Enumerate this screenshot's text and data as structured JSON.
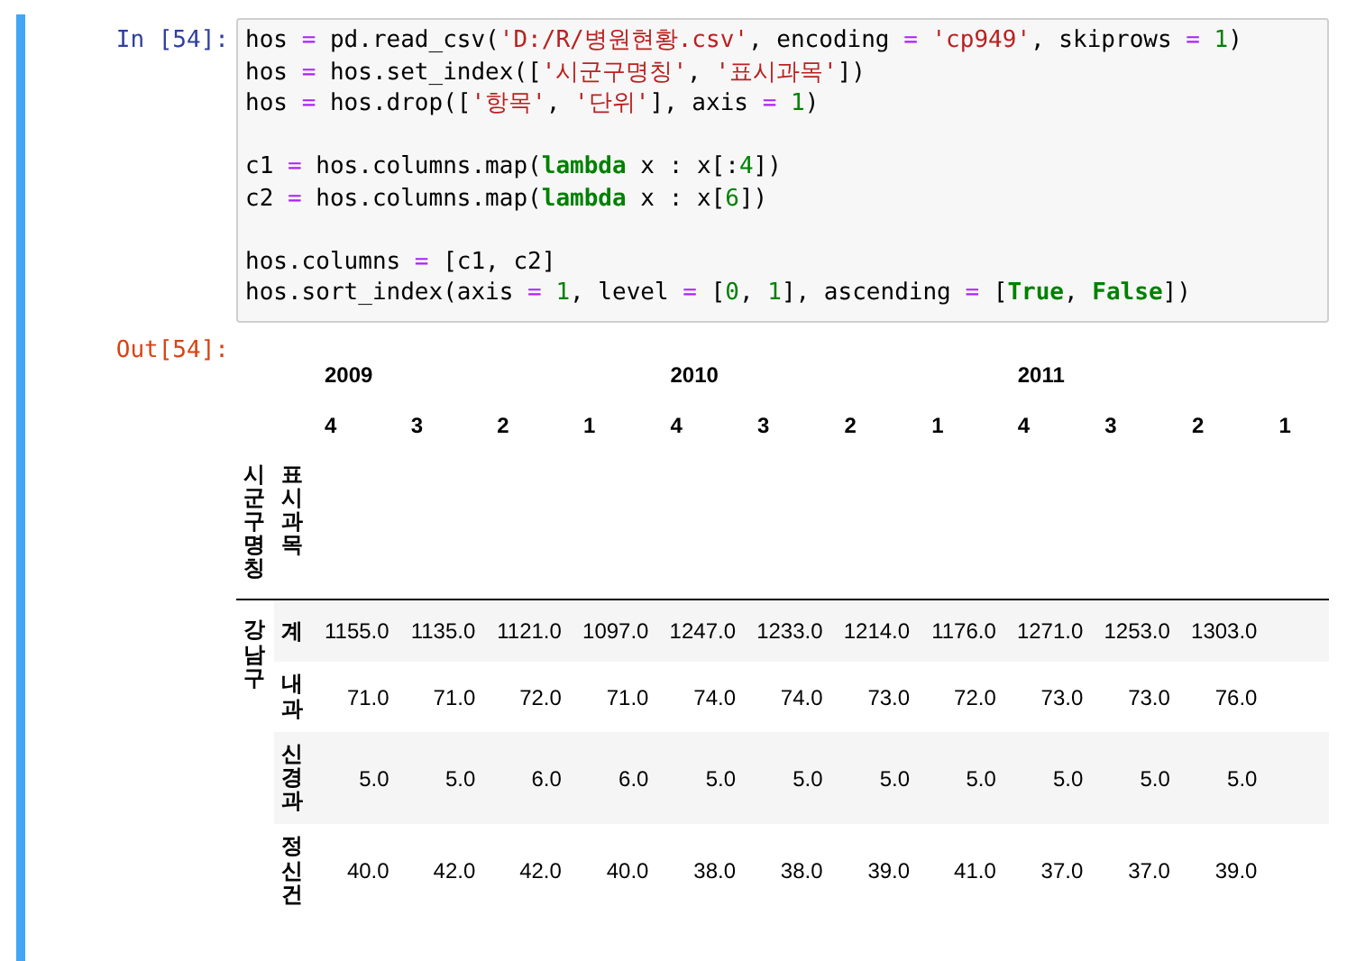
{
  "input_prompt": "In [54]:",
  "code_blocks": [
    [
      {
        "tokens": [
          {
            "kind": "name",
            "text": "hos "
          },
          {
            "kind": "op",
            "text": "="
          },
          {
            "kind": "name",
            "text": " pd.read_csv("
          },
          {
            "kind": "str",
            "text": "'D:/R/병원현황.csv'"
          },
          {
            "kind": "name",
            "text": ", encoding "
          },
          {
            "kind": "op",
            "text": "="
          },
          {
            "kind": "str",
            "text": " 'cp949'"
          },
          {
            "kind": "name",
            "text": ", skiprows "
          },
          {
            "kind": "op",
            "text": "="
          },
          {
            "kind": "num",
            "text": " 1"
          },
          {
            "kind": "name",
            "text": ")"
          }
        ]
      },
      {
        "tokens": [
          {
            "kind": "name",
            "text": "hos "
          },
          {
            "kind": "op",
            "text": "="
          },
          {
            "kind": "name",
            "text": " hos.set_index(["
          },
          {
            "kind": "str",
            "text": "'시군구명칭'"
          },
          {
            "kind": "name",
            "text": ", "
          },
          {
            "kind": "str",
            "text": "'표시과목'"
          },
          {
            "kind": "name",
            "text": "])"
          }
        ]
      },
      {
        "tokens": [
          {
            "kind": "name",
            "text": "hos "
          },
          {
            "kind": "op",
            "text": "="
          },
          {
            "kind": "name",
            "text": " hos.drop(["
          },
          {
            "kind": "str",
            "text": "'항목'"
          },
          {
            "kind": "name",
            "text": ", "
          },
          {
            "kind": "str",
            "text": "'단위'"
          },
          {
            "kind": "name",
            "text": "], axis "
          },
          {
            "kind": "op",
            "text": "="
          },
          {
            "kind": "num",
            "text": " 1"
          },
          {
            "kind": "name",
            "text": ")"
          }
        ]
      }
    ],
    [
      {
        "tokens": [
          {
            "kind": "name",
            "text": "c1 "
          },
          {
            "kind": "op",
            "text": "="
          },
          {
            "kind": "name",
            "text": " hos.columns.map("
          },
          {
            "kind": "kw",
            "text": "lambda"
          },
          {
            "kind": "name",
            "text": " x : x[:"
          },
          {
            "kind": "num",
            "text": "4"
          },
          {
            "kind": "name",
            "text": "])"
          }
        ]
      },
      {
        "tokens": [
          {
            "kind": "name",
            "text": "c2 "
          },
          {
            "kind": "op",
            "text": "="
          },
          {
            "kind": "name",
            "text": " hos.columns.map("
          },
          {
            "kind": "kw",
            "text": "lambda"
          },
          {
            "kind": "name",
            "text": " x : x["
          },
          {
            "kind": "num",
            "text": "6"
          },
          {
            "kind": "name",
            "text": "])"
          }
        ]
      }
    ],
    [
      {
        "tokens": [
          {
            "kind": "name",
            "text": "hos.columns "
          },
          {
            "kind": "op",
            "text": "="
          },
          {
            "kind": "name",
            "text": " [c1, c2]"
          }
        ]
      },
      {
        "tokens": [
          {
            "kind": "name",
            "text": "hos.sort_index(axis "
          },
          {
            "kind": "op",
            "text": "="
          },
          {
            "kind": "num",
            "text": " 1"
          },
          {
            "kind": "name",
            "text": ", level "
          },
          {
            "kind": "op",
            "text": "="
          },
          {
            "kind": "name",
            "text": " ["
          },
          {
            "kind": "num",
            "text": "0"
          },
          {
            "kind": "name",
            "text": ", "
          },
          {
            "kind": "num",
            "text": "1"
          },
          {
            "kind": "name",
            "text": "], ascending "
          },
          {
            "kind": "op",
            "text": "="
          },
          {
            "kind": "name",
            "text": " ["
          },
          {
            "kind": "kw",
            "text": "True"
          },
          {
            "kind": "name",
            "text": ", "
          },
          {
            "kind": "kw",
            "text": "False"
          },
          {
            "kind": "name",
            "text": "])"
          }
        ]
      }
    ]
  ],
  "output_prompt": "Out[54]:",
  "table": {
    "years": [
      {
        "label": "2009",
        "quarters": [
          "4",
          "3",
          "2",
          "1"
        ]
      },
      {
        "label": "2010",
        "quarters": [
          "4",
          "3",
          "2",
          "1"
        ]
      },
      {
        "label": "2011",
        "quarters": [
          "4",
          "3",
          "2",
          "1"
        ]
      }
    ],
    "index_names": [
      "시군구명칭",
      "표시과목"
    ],
    "groups": [
      {
        "label": "강남구",
        "rows": [
          {
            "label": "계",
            "values": [
              "1155.0",
              "1135.0",
              "1121.0",
              "1097.0",
              "1247.0",
              "1233.0",
              "1214.0",
              "1176.0",
              "1271.0",
              "1253.0",
              "1303.0"
            ]
          },
          {
            "label": "내과",
            "values": [
              "71.0",
              "71.0",
              "72.0",
              "71.0",
              "74.0",
              "74.0",
              "73.0",
              "72.0",
              "73.0",
              "73.0",
              "76.0"
            ]
          },
          {
            "label": "신경과",
            "values": [
              "5.0",
              "5.0",
              "6.0",
              "6.0",
              "5.0",
              "5.0",
              "5.0",
              "5.0",
              "5.0",
              "5.0",
              "5.0"
            ]
          },
          {
            "label": "정신건",
            "values": [
              "40.0",
              "42.0",
              "42.0",
              "40.0",
              "38.0",
              "38.0",
              "39.0",
              "41.0",
              "37.0",
              "37.0",
              "39.0"
            ]
          }
        ]
      }
    ]
  }
}
